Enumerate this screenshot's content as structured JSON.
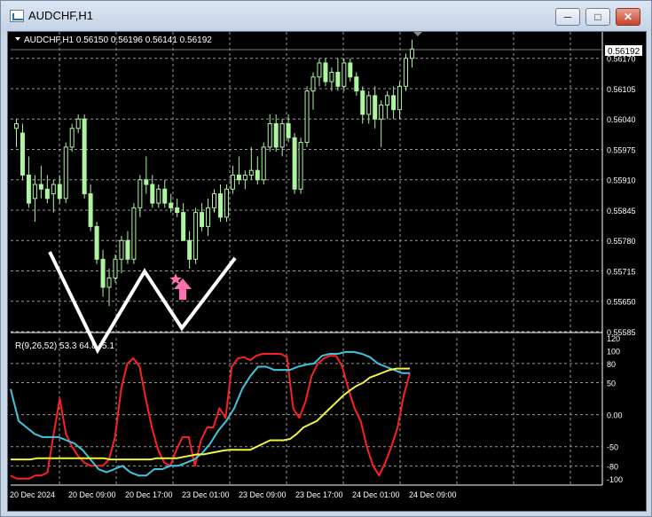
{
  "window": {
    "title": "AUDCHF,H1",
    "minimize_icon": "minimize-icon",
    "maximize_icon": "maximize-icon",
    "close_icon": "close-icon"
  },
  "chart": {
    "header": "AUDCHF,H1  0.56150 0.56196 0.56141 0.56192",
    "current_price": "0.56192",
    "colors": {
      "background": "#000000",
      "grid": "#9a9a9a",
      "candle": "#aef5a0",
      "text": "#ffffff",
      "red_line": "#ff2020",
      "cyan_line": "#3ec6e0",
      "yellow_line": "#f4f43c",
      "arrow": "#ff6fae"
    }
  },
  "indicator": {
    "label": "R(9,26,52) 53.3 64.8 ",
    "label_hidden_tail": "5.1"
  },
  "chart_data": {
    "type": "candlestick",
    "price_axis_ticks": [
      "0.56170",
      "0.56105",
      "0.56040",
      "0.55975",
      "0.55910",
      "0.55845",
      "0.55780",
      "0.55715",
      "0.55650",
      "0.55585"
    ],
    "indicator_axis_ticks": [
      "120",
      "100",
      "80",
      "50",
      "0.00",
      "-50",
      "-80",
      "-100"
    ],
    "time_axis_ticks": [
      "20 Dec 2024",
      "20 Dec 09:00",
      "20 Dec 17:00",
      "23 Dec 01:00",
      "23 Dec 09:00",
      "23 Dec 17:00",
      "24 Dec 01:00",
      "24 Dec 09:00"
    ],
    "price_range": [
      0.55585,
      0.56215
    ],
    "candles": [
      [
        0.5602,
        0.5604,
        0.5598,
        0.5603
      ],
      [
        0.5601,
        0.5603,
        0.5591,
        0.5592
      ],
      [
        0.5592,
        0.5596,
        0.5585,
        0.5586
      ],
      [
        0.5587,
        0.5592,
        0.5582,
        0.559
      ],
      [
        0.559,
        0.5594,
        0.5587,
        0.5589
      ],
      [
        0.5589,
        0.5592,
        0.5586,
        0.5587
      ],
      [
        0.5588,
        0.5591,
        0.5584,
        0.559
      ],
      [
        0.559,
        0.5592,
        0.5586,
        0.5587
      ],
      [
        0.5587,
        0.5599,
        0.5586,
        0.5598
      ],
      [
        0.5598,
        0.5603,
        0.5597,
        0.5602
      ],
      [
        0.5602,
        0.5605,
        0.5601,
        0.5604
      ],
      [
        0.5604,
        0.5605,
        0.5587,
        0.5588
      ],
      [
        0.5588,
        0.559,
        0.558,
        0.5581
      ],
      [
        0.5581,
        0.5582,
        0.5573,
        0.5574
      ],
      [
        0.5574,
        0.5576,
        0.5566,
        0.5568
      ],
      [
        0.5568,
        0.5572,
        0.5564,
        0.557
      ],
      [
        0.557,
        0.5575,
        0.5569,
        0.5574
      ],
      [
        0.5574,
        0.5579,
        0.5571,
        0.5578
      ],
      [
        0.5578,
        0.558,
        0.5573,
        0.5574
      ],
      [
        0.5574,
        0.5586,
        0.5573,
        0.5585
      ],
      [
        0.5585,
        0.5592,
        0.5583,
        0.5591
      ],
      [
        0.5591,
        0.5596,
        0.5588,
        0.559
      ],
      [
        0.559,
        0.5592,
        0.5585,
        0.5586
      ],
      [
        0.5586,
        0.559,
        0.5585,
        0.5589
      ],
      [
        0.5589,
        0.5591,
        0.5585,
        0.5586
      ],
      [
        0.5586,
        0.5588,
        0.5584,
        0.5585
      ],
      [
        0.5585,
        0.5587,
        0.5583,
        0.5584
      ],
      [
        0.5584,
        0.5586,
        0.558,
        0.5578
      ],
      [
        0.5578,
        0.558,
        0.5572,
        0.5574
      ],
      [
        0.5574,
        0.5585,
        0.5573,
        0.5584
      ],
      [
        0.5584,
        0.5586,
        0.558,
        0.5581
      ],
      [
        0.5581,
        0.5587,
        0.5579,
        0.5585
      ],
      [
        0.5585,
        0.5589,
        0.5584,
        0.5588
      ],
      [
        0.5588,
        0.559,
        0.5582,
        0.5583
      ],
      [
        0.5583,
        0.559,
        0.5582,
        0.5589
      ],
      [
        0.5589,
        0.5594,
        0.5588,
        0.5592
      ],
      [
        0.5592,
        0.5596,
        0.559,
        0.5591
      ],
      [
        0.5591,
        0.5593,
        0.5589,
        0.5592
      ],
      [
        0.5592,
        0.5598,
        0.5591,
        0.5593
      ],
      [
        0.5593,
        0.5596,
        0.559,
        0.5591
      ],
      [
        0.5591,
        0.5599,
        0.559,
        0.5598
      ],
      [
        0.5598,
        0.5605,
        0.5597,
        0.5603
      ],
      [
        0.5603,
        0.5605,
        0.5597,
        0.5598
      ],
      [
        0.5598,
        0.5604,
        0.5596,
        0.5603
      ],
      [
        0.5603,
        0.5605,
        0.5599,
        0.56
      ],
      [
        0.56,
        0.5601,
        0.5588,
        0.5589
      ],
      [
        0.5589,
        0.56,
        0.5588,
        0.5599
      ],
      [
        0.5599,
        0.5611,
        0.5598,
        0.561
      ],
      [
        0.561,
        0.5614,
        0.5606,
        0.5613
      ],
      [
        0.5613,
        0.5617,
        0.5611,
        0.5616
      ],
      [
        0.5616,
        0.5617,
        0.5611,
        0.5612
      ],
      [
        0.5612,
        0.5615,
        0.561,
        0.5614
      ],
      [
        0.5614,
        0.5617,
        0.561,
        0.5611
      ],
      [
        0.5611,
        0.5617,
        0.561,
        0.5616
      ],
      [
        0.5616,
        0.5617,
        0.5612,
        0.5613
      ],
      [
        0.5613,
        0.5614,
        0.5609,
        0.561
      ],
      [
        0.561,
        0.5611,
        0.5603,
        0.5605
      ],
      [
        0.5605,
        0.561,
        0.5603,
        0.5609
      ],
      [
        0.5609,
        0.5611,
        0.5602,
        0.5604
      ],
      [
        0.5604,
        0.5608,
        0.5598,
        0.5607
      ],
      [
        0.5607,
        0.561,
        0.5604,
        0.5609
      ],
      [
        0.5609,
        0.5611,
        0.5604,
        0.5606
      ],
      [
        0.5606,
        0.5612,
        0.5604,
        0.5611
      ],
      [
        0.5611,
        0.5618,
        0.561,
        0.5617
      ],
      [
        0.5617,
        0.5621,
        0.5615,
        0.5619
      ]
    ],
    "series": [
      {
        "name": "red",
        "values": [
          -95,
          -100,
          -100,
          -100,
          -95,
          -95,
          -90,
          -30,
          25,
          -30,
          -50,
          -65,
          -75,
          -80,
          -80,
          -80,
          -70,
          -35,
          40,
          80,
          88,
          75,
          25,
          -20,
          -55,
          -75,
          -80,
          -55,
          -35,
          -35,
          -80,
          -40,
          -20,
          -20,
          10,
          -5,
          75,
          88,
          90,
          85,
          92,
          95,
          95,
          95,
          95,
          90,
          10,
          -5,
          20,
          60,
          80,
          88,
          92,
          92,
          75,
          40,
          10,
          -10,
          -50,
          -80,
          -95,
          -75,
          -50,
          -20,
          30,
          65
        ]
      },
      {
        "name": "cyan",
        "values": [
          40,
          -10,
          -20,
          -30,
          -35,
          -35,
          -35,
          -40,
          -45,
          -55,
          -70,
          -85,
          -90,
          -85,
          -80,
          -90,
          -95,
          -95,
          -85,
          -85,
          -80,
          -80,
          -75,
          -70,
          -60,
          -45,
          -25,
          -10,
          10,
          40,
          60,
          75,
          75,
          70,
          70,
          70,
          75,
          78,
          80,
          92,
          95,
          95,
          98,
          98,
          95,
          90,
          80,
          75,
          70,
          65,
          65
        ]
      },
      {
        "name": "yellow",
        "values": [
          -70,
          -70,
          -70,
          -70,
          -68,
          -68,
          -68,
          -68,
          -68,
          -68,
          -68,
          -68,
          -68,
          -68,
          -68,
          -70,
          -70,
          -70,
          -70,
          -70,
          -70,
          -70,
          -68,
          -68,
          -68,
          -68,
          -66,
          -64,
          -62,
          -62,
          -60,
          -58,
          -56,
          -55,
          -55,
          -55,
          -55,
          -50,
          -45,
          -40,
          -40,
          -40,
          -38,
          -30,
          -20,
          -15,
          -10,
          0,
          10,
          20,
          30,
          38,
          45,
          50,
          58,
          62,
          66,
          70,
          72,
          72,
          72
        ]
      }
    ]
  }
}
